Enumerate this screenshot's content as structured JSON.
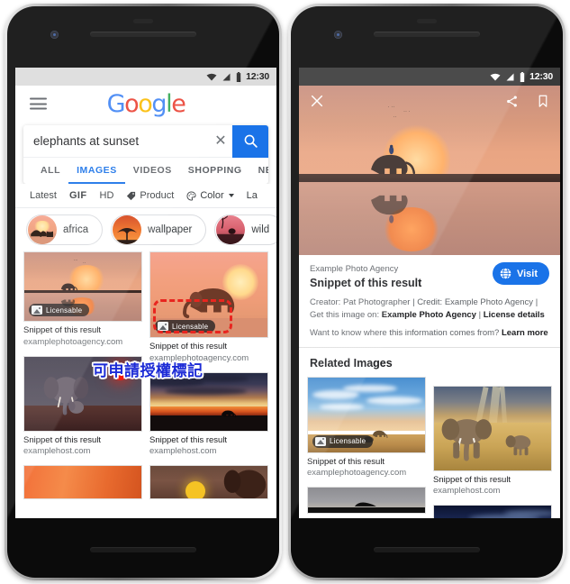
{
  "left_phone": {
    "statusbar": {
      "time": "12:30",
      "icons": [
        "wifi-icon",
        "signal-icon",
        "battery-icon"
      ]
    },
    "header": {
      "menu_icon": "hamburger-menu-icon",
      "logo_letters": [
        "G",
        "o",
        "o",
        "g",
        "l",
        "e"
      ],
      "logo_text": "Google"
    },
    "search": {
      "value": "elephants at sunset",
      "placeholder": "Search",
      "clear_icon": "close-x-icon",
      "search_icon": "search-magnifier-icon"
    },
    "tabs": [
      {
        "label": "ALL",
        "active": false
      },
      {
        "label": "IMAGES",
        "active": true
      },
      {
        "label": "VIDEOS",
        "active": false
      },
      {
        "label": "SHOPPING",
        "active": false
      },
      {
        "label": "NEWS",
        "active": false
      }
    ],
    "filters": [
      {
        "label": "Latest",
        "icon": null,
        "bold": false,
        "caret": false
      },
      {
        "label": "GIF",
        "icon": null,
        "bold": true,
        "caret": false
      },
      {
        "label": "HD",
        "icon": null,
        "bold": false,
        "caret": false
      },
      {
        "label": "Product",
        "icon": "tag-icon",
        "bold": false,
        "caret": false
      },
      {
        "label": "Color",
        "icon": "palette-icon",
        "bold": false,
        "caret": true
      },
      {
        "label": "La",
        "icon": null,
        "bold": false,
        "caret": false
      }
    ],
    "related_chips": [
      {
        "label": "africa"
      },
      {
        "label": "wallpaper"
      },
      {
        "label": "wild"
      }
    ],
    "results": [
      {
        "snippet": "Snippet of this result",
        "host": "examplephotoagency.com",
        "licensable": true,
        "badge_label": "Licensable",
        "column": "left"
      },
      {
        "snippet": "Snippet of this result",
        "host": "examplephotoagency.com",
        "licensable": true,
        "badge_label": "Licensable",
        "column": "right"
      },
      {
        "snippet": "Snippet of this result",
        "host": "examplehost.com",
        "licensable": false,
        "badge_label": "",
        "column": "left"
      },
      {
        "snippet": "Snippet of this result",
        "host": "examplehost.com",
        "licensable": false,
        "badge_label": "",
        "column": "right"
      }
    ],
    "annotation": {
      "overlay_text": "可申請授權標記",
      "overlay_color": "#1c2bd6",
      "box_color": "#e8251f",
      "box_style": "dashed"
    }
  },
  "right_phone": {
    "statusbar": {
      "time": "12:30",
      "icons": [
        "wifi-icon",
        "signal-icon",
        "battery-icon"
      ]
    },
    "viewer_toolbar": {
      "close_icon": "close-x-icon",
      "share_icon": "share-icon",
      "bookmark_icon": "bookmark-icon"
    },
    "detail": {
      "source": "Example Photo Agency",
      "title": "Snippet of this result",
      "visit_label": "Visit",
      "visit_icon": "globe-icon",
      "meta_line1_prefix": "Creator: ",
      "meta_line1_creator": "Pat Photographer",
      "meta_line1_mid": " | Credit: ",
      "meta_line1_credit": "Example Photo Agency",
      "meta_line1_suffix": " |",
      "meta_line2_prefix": "Get this image on: ",
      "meta_line2_link1": "Example Photo Agency",
      "meta_line2_sep": " | ",
      "meta_line2_link2": "License details",
      "learn_prefix": "Want to know where this information comes from? ",
      "learn_link": "Learn more"
    },
    "related": {
      "title": "Related Images",
      "items": [
        {
          "snippet": "Snippet of this result",
          "host": "examplephotoagency.com",
          "licensable": true,
          "badge_label": "Licensable"
        },
        {
          "snippet": "Snippet of this result",
          "host": "examplehost.com",
          "licensable": false,
          "badge_label": ""
        }
      ]
    }
  },
  "colors": {
    "google_blue": "#1a73e8",
    "logo_blue": "#4285f4",
    "logo_red": "#ea4335",
    "logo_yellow": "#fbbc05",
    "logo_green": "#34a853",
    "annotation_red": "#e8251f",
    "annotation_blue": "#1c2bd6"
  }
}
